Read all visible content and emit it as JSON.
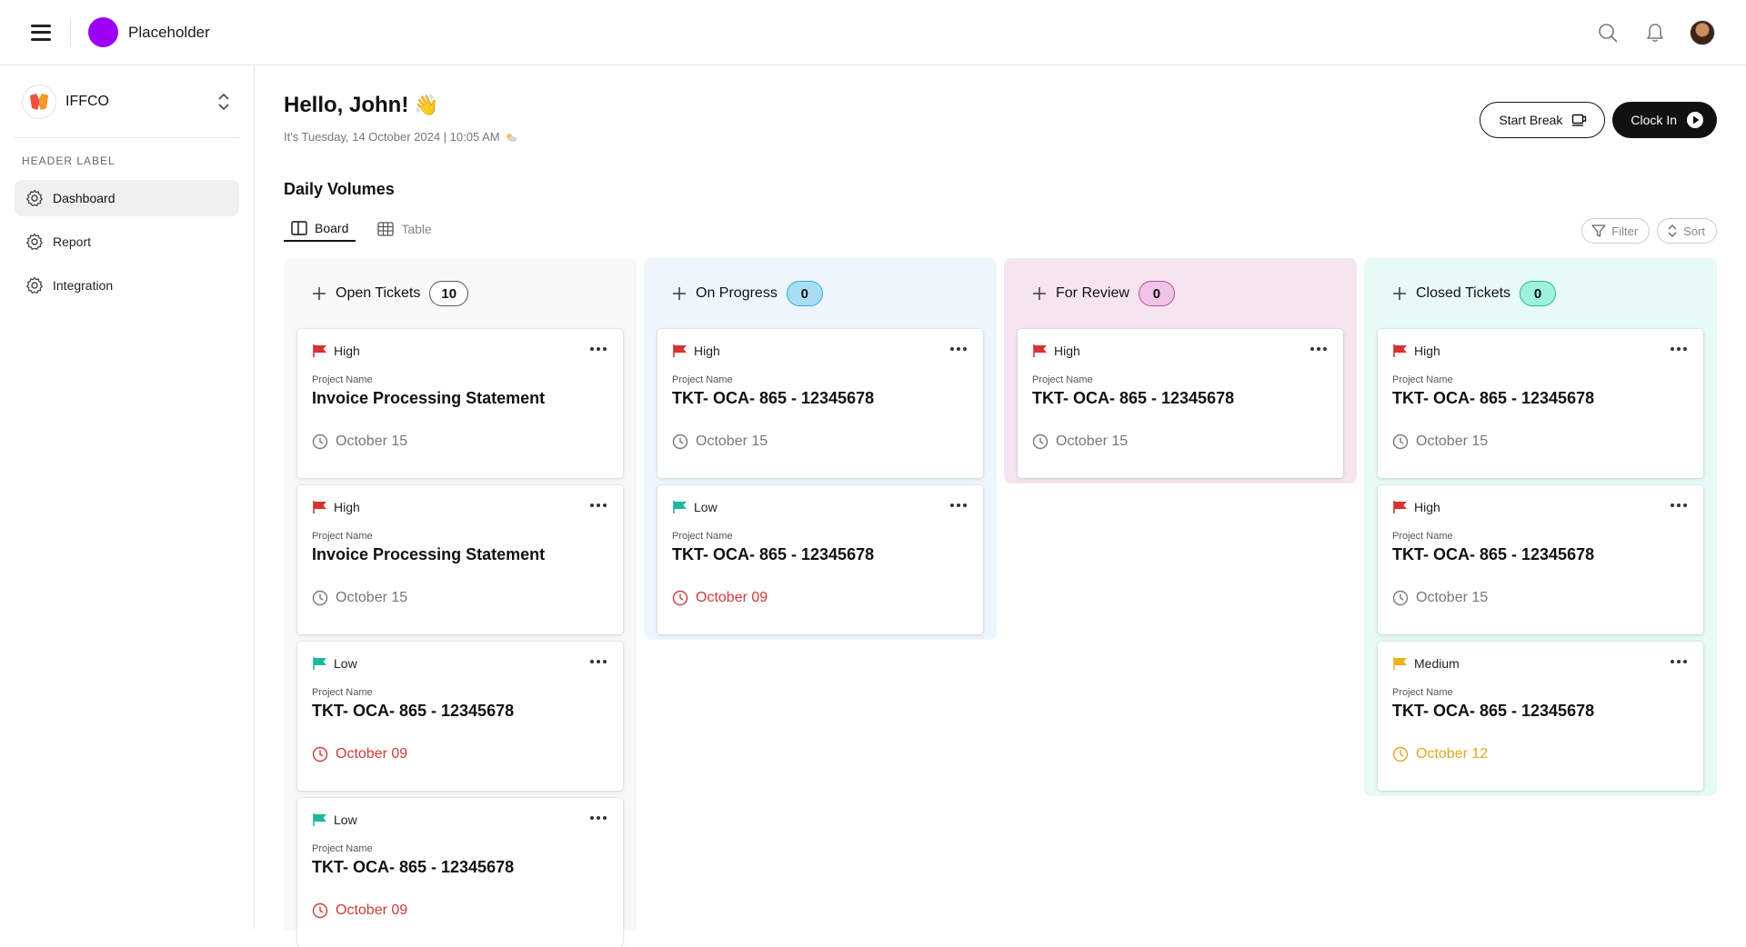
{
  "topbar": {
    "brand": "Placeholder"
  },
  "sidebar": {
    "org_name": "IFFCO",
    "section_label": "HEADER LABEL",
    "items": [
      {
        "label": "Dashboard",
        "icon": "gear-icon",
        "active": true
      },
      {
        "label": "Report",
        "icon": "gear-icon",
        "active": false
      },
      {
        "label": "Integration",
        "icon": "gear-icon",
        "active": false
      }
    ]
  },
  "header": {
    "greeting": "Hello, John!",
    "wave": "👋",
    "date_line": "It's Tuesday, 14 October 2024 | 10:05 AM",
    "start_break": "Start Break",
    "clock_in": "Clock In",
    "section_title": "Daily Volumes"
  },
  "view_tabs": [
    {
      "label": "Board",
      "icon": "board-icon",
      "active": true
    },
    {
      "label": "Table",
      "icon": "table-icon",
      "active": false
    }
  ],
  "tools": {
    "filter": "Filter",
    "sort": "Sort"
  },
  "columns": [
    {
      "title": "Open Tickets",
      "count": "10",
      "bg": "#f8f8f8",
      "pill_bg": "#ffffff",
      "pill_border": "#555555",
      "cards": [
        {
          "priority": "High",
          "project_label": "Project Name",
          "project": "Invoice Processing Statement",
          "date": "October 15",
          "date_color": "#777777"
        },
        {
          "priority": "High",
          "project_label": "Project Name",
          "project": "Invoice Processing Statement",
          "date": "October 15",
          "date_color": "#777777"
        },
        {
          "priority": "Low",
          "project_label": "Project Name",
          "project": "TKT- OCA- 865 - 12345678",
          "date": "October 09",
          "date_color": "#d03a3a"
        },
        {
          "priority": "Low",
          "project_label": "Project Name",
          "project": "TKT- OCA- 865 - 12345678",
          "date": "October 09",
          "date_color": "#d03a3a"
        }
      ]
    },
    {
      "title": "On Progress",
      "count": "0",
      "bg": "#eef6fd",
      "pill_bg": "#a8def5",
      "pill_border": "#3aa6d6",
      "cards": [
        {
          "priority": "High",
          "project_label": "Project Name",
          "project": "TKT- OCA- 865 - 12345678",
          "date": "October 15",
          "date_color": "#777777"
        },
        {
          "priority": "Low",
          "project_label": "Project Name",
          "project": "TKT- OCA- 865 - 12345678",
          "date": "October 09",
          "date_color": "#d03a3a"
        }
      ]
    },
    {
      "title": "For Review",
      "count": "0",
      "bg": "#f6e5f1",
      "pill_bg": "#f0c4e6",
      "pill_border": "#b3529c",
      "cards": [
        {
          "priority": "High",
          "project_label": "Project Name",
          "project": "TKT- OCA- 865 - 12345678",
          "date": "October 15",
          "date_color": "#777777"
        }
      ]
    },
    {
      "title": "Closed Tickets",
      "count": "0",
      "bg": "#e7faf5",
      "pill_bg": "#9ff0dc",
      "pill_border": "#2bb894",
      "cards": [
        {
          "priority": "High",
          "project_label": "Project Name",
          "project": "TKT- OCA- 865 - 12345678",
          "date": "October 15",
          "date_color": "#777777"
        },
        {
          "priority": "High",
          "project_label": "Project Name",
          "project": "TKT- OCA- 865 - 12345678",
          "date": "October 15",
          "date_color": "#777777"
        },
        {
          "priority": "Medium",
          "project_label": "Project Name",
          "project": "TKT- OCA- 865 - 12345678",
          "date": "October 12",
          "date_color": "#e0a820"
        }
      ]
    }
  ],
  "priority_colors": {
    "High": "#d63232",
    "Low": "#1fb6a0",
    "Medium": "#f0b020"
  }
}
